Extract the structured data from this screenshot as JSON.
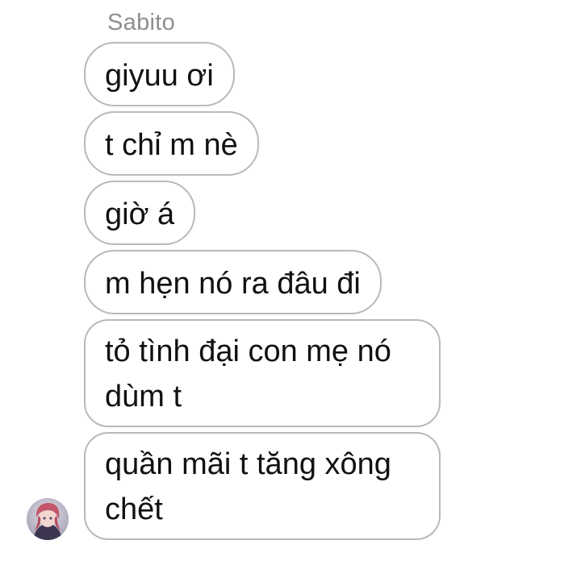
{
  "conversation": {
    "sender_name": "Sabito",
    "avatar_icon": "user-avatar-icon",
    "messages": [
      {
        "lines": [
          "giyuu ơi"
        ]
      },
      {
        "lines": [
          "t chỉ m nè"
        ]
      },
      {
        "lines": [
          "giờ á"
        ]
      },
      {
        "lines": [
          "m hẹn nó ra đâu đi"
        ]
      },
      {
        "lines": [
          "tỏ tình đại con mẹ nó",
          "dùm t"
        ]
      },
      {
        "lines": [
          "quần mãi t tăng xông",
          "chết"
        ]
      }
    ]
  },
  "colors": {
    "bubble_border": "#b9b9bd",
    "sender_name": "#8e8e93",
    "text": "#111111",
    "background": "#ffffff"
  }
}
